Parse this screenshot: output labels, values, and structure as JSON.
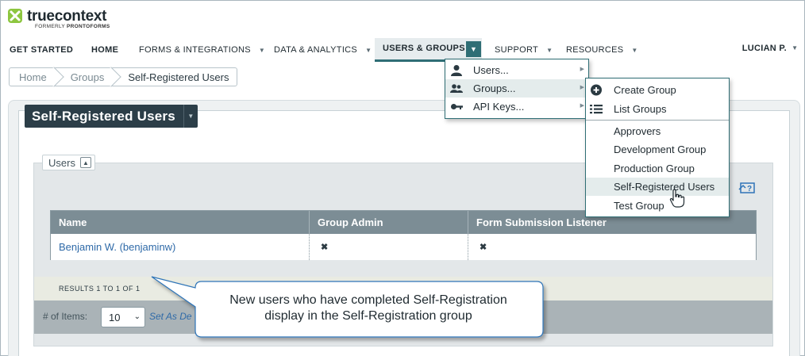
{
  "brand": {
    "name": "truecontext",
    "sub_prefix": "FORMERLY ",
    "sub_name": "PRONTOFORMS",
    "accent": "#8dc63f"
  },
  "nav": {
    "items": [
      {
        "label": "GET STARTED"
      },
      {
        "label": "HOME"
      },
      {
        "label": "FORMS & INTEGRATIONS"
      },
      {
        "label": "DATA & ANALYTICS"
      },
      {
        "label": "USERS & GROUPS"
      },
      {
        "label": "SUPPORT"
      },
      {
        "label": "RESOURCES"
      }
    ],
    "user": "LUCIAN P."
  },
  "breadcrumb": [
    "Home",
    "Groups",
    "Self-Registered Users"
  ],
  "page_title": "Self-Registered Users",
  "users_section": {
    "label": "Users",
    "table": {
      "columns": [
        "Name",
        "Group Admin",
        "Form Submission Listener"
      ],
      "rows": [
        {
          "name": "Benjamin W. (benjaminw)",
          "group_admin": "✖",
          "form_listener": "✖"
        }
      ]
    },
    "results": "RESULTS 1 TO 1 OF 1",
    "pager": {
      "label": "# of Items:",
      "value": "10",
      "set_default": "Set As De"
    }
  },
  "menu": {
    "items": [
      {
        "label": "Users...",
        "icon": "user-icon"
      },
      {
        "label": "Groups...",
        "icon": "group-icon"
      },
      {
        "label": "API Keys...",
        "icon": "key-icon"
      }
    ]
  },
  "submenu": {
    "actions": [
      {
        "label": "Create Group",
        "icon": "plus-circle-icon"
      },
      {
        "label": "List Groups",
        "icon": "list-icon"
      }
    ],
    "groups": [
      "Approvers",
      "Development Group",
      "Production Group",
      "Self-Registered Users",
      "Test Group"
    ]
  },
  "callout": {
    "line1": "New users who have completed Self-Registration",
    "line2": "display in the Self-Registration group"
  },
  "colors": {
    "nav_active": "#2f6e75",
    "title_bg": "#2c3e48",
    "table_header": "#7c8d95",
    "link": "#2f6aa8"
  }
}
